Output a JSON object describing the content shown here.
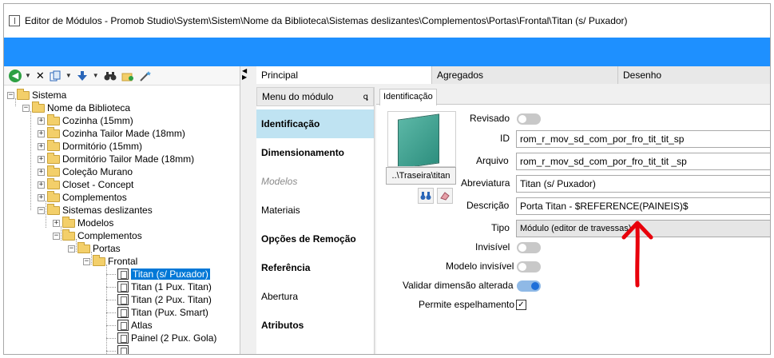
{
  "window": {
    "title": "Editor de Módulos - Promob Studio\\System\\Sistem\\Nome da Biblioteca\\Sistemas deslizantes\\Complementos\\Portas\\Frontal\\Titan (s/ Puxador)"
  },
  "toolbar": {
    "icons": [
      "back-arrow-icon",
      "dropdown-icon",
      "delete-icon",
      "copy-icon",
      "dropdown-icon",
      "move-down-icon",
      "dropdown-icon",
      "binoculars-icon",
      "folder-refresh-icon",
      "wand-icon"
    ],
    "delete_glyph": "✕",
    "back_glyph": "◀"
  },
  "tree": {
    "items": [
      {
        "label": "Sistema",
        "type": "folder",
        "expander": "−"
      },
      {
        "label": "Nome da Biblioteca",
        "type": "folder",
        "expander": "−"
      },
      {
        "label": "Cozinha (15mm)",
        "type": "folder",
        "expander": "+"
      },
      {
        "label": "Cozinha Tailor Made (18mm)",
        "type": "folder",
        "expander": "+"
      },
      {
        "label": "Dormitório (15mm)",
        "type": "folder",
        "expander": "+"
      },
      {
        "label": "Dormitório Tailor Made (18mm)",
        "type": "folder",
        "expander": "+"
      },
      {
        "label": "Coleção Murano",
        "type": "folder",
        "expander": "+"
      },
      {
        "label": "Closet - Concept",
        "type": "folder",
        "expander": "+"
      },
      {
        "label": "Complementos",
        "type": "folder",
        "expander": "+"
      },
      {
        "label": "Sistemas deslizantes",
        "type": "folder",
        "expander": "−"
      },
      {
        "label": "Modelos",
        "type": "folder",
        "expander": "+"
      },
      {
        "label": "Complementos",
        "type": "folder",
        "expander": "−"
      },
      {
        "label": "Portas",
        "type": "folder",
        "expander": "−"
      },
      {
        "label": "Frontal",
        "type": "folder",
        "expander": "−"
      },
      {
        "label": "Titan (s/ Puxador)",
        "type": "module",
        "selected": true
      },
      {
        "label": "Titan (1 Pux. Titan)",
        "type": "module"
      },
      {
        "label": "Titan (2 Pux. Titan)",
        "type": "module"
      },
      {
        "label": "Titan (Pux. Smart)",
        "type": "module"
      },
      {
        "label": "Atlas",
        "type": "module"
      },
      {
        "label": "Painel (2 Pux. Gola)",
        "type": "module"
      }
    ]
  },
  "tabs": [
    {
      "label": "Principal",
      "active": true
    },
    {
      "label": "Agregados",
      "active": false
    },
    {
      "label": "Desenho",
      "active": false
    }
  ],
  "menu": {
    "header": "Menu do módulo",
    "pin": "ꝗ",
    "items": [
      {
        "label": "Identificação",
        "state": "active"
      },
      {
        "label": "Dimensionamento",
        "state": "bold"
      },
      {
        "label": "Modelos",
        "state": "disabled"
      },
      {
        "label": "Materiais",
        "state": "normal"
      },
      {
        "label": "Opções de Remoção",
        "state": "bold"
      },
      {
        "label": "Referência",
        "state": "bold"
      },
      {
        "label": "Abertura",
        "state": "normal"
      },
      {
        "label": "Atributos",
        "state": "bold"
      }
    ]
  },
  "identificacao": {
    "tab_label": "Identificação",
    "path_button": "..\\Traseira\\titan",
    "find_glyph": "🔍",
    "eraser_glyph": "◆",
    "fields": {
      "revisado_label": "Revisado",
      "revisado_on": false,
      "id_label": "ID",
      "id_value": "rom_r_mov_sd_com_por_fro_tit_tit_sp",
      "arquivo_label": "Arquivo",
      "arquivo_value": "rom_r_mov_sd_com_por_fro_tit_tit _sp",
      "abreviatura_label": "Abreviatura",
      "abreviatura_value": "Titan (s/ Puxador)",
      "descricao_label": "Descrição",
      "descricao_value": "Porta Titan - $REFERENCE(PAINEIS)$",
      "tipo_label": "Tipo",
      "tipo_value": "Módulo (editor de travessas)",
      "invisivel_label": "Invisível",
      "invisivel_on": false,
      "modelo_invisivel_label": "Modelo invisível",
      "modelo_invisivel_on": false,
      "validar_label": "Validar dimensão alterada",
      "validar_on": true,
      "espelhamento_label": "Permite espelhamento",
      "espelhamento_checked": true,
      "check_glyph": "✓"
    }
  },
  "colors": {
    "accent_bar": "#1e90ff",
    "selection": "#0078d7",
    "active_menu": "#bfe3f2",
    "annotation_arrow": "#e8000b"
  }
}
